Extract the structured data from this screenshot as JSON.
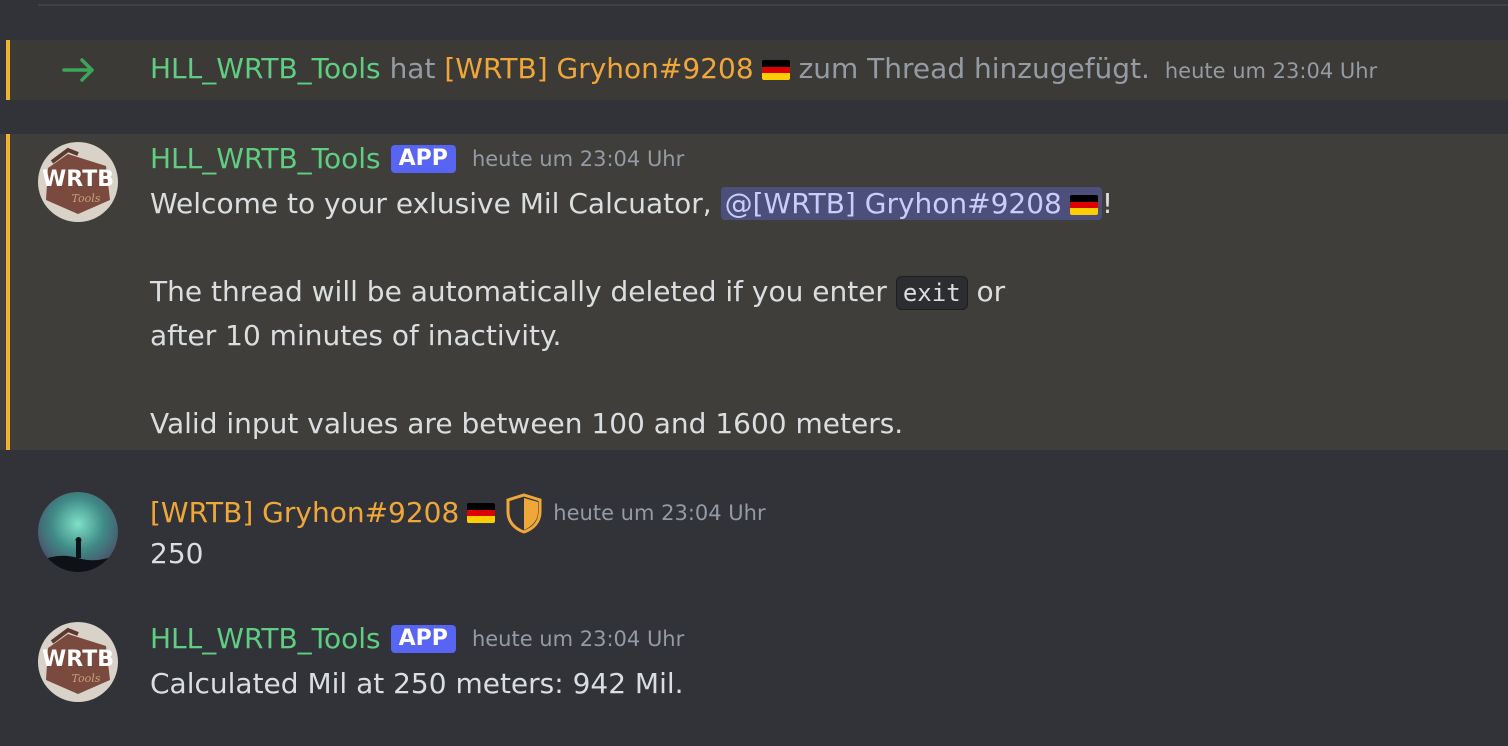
{
  "system": {
    "actor": "HLL_WRTB_Tools",
    "verb": "hat",
    "target": "[WRTB] Gryhon#9208",
    "suffix": "zum Thread hinzugefügt.",
    "timestamp": "heute um 23:04 Uhr"
  },
  "messages": [
    {
      "author": "HLL_WRTB_Tools",
      "badge": "APP",
      "timestamp": "heute um 23:04 Uhr",
      "line1_prefix": "Welcome to your exlusive Mil Calcuator, ",
      "mention": "@[WRTB] Gryhon#9208",
      "line1_suffix": "!",
      "line3_prefix": "The thread will be automatically deleted if you enter ",
      "code": "exit",
      "line3_suffix": " or",
      "line4": "after 10 minutes of inactivity.",
      "line6": "Valid input values are between 100 and 1600 meters."
    },
    {
      "author": "[WRTB] Gryhon#9208",
      "timestamp": "heute um 23:04 Uhr",
      "text": "250"
    },
    {
      "author": "HLL_WRTB_Tools",
      "badge": "APP",
      "timestamp": "heute um 23:04 Uhr",
      "text": "Calculated Mil at 250 meters: 942 Mil."
    }
  ],
  "colors": {
    "background": "#313338",
    "highlight": "#403e3a",
    "highlight_bar": "#f0b232",
    "bot_name": "#5fce82",
    "user_name": "#f0a73a",
    "app_badge": "#5865f2",
    "mention_bg": "#4c4f7a"
  },
  "avatar_logo_text": "WRTB",
  "avatar_logo_subtext": "Tools",
  "icons": [
    "arrow-right-icon",
    "germany-flag-icon",
    "shield-icon"
  ]
}
